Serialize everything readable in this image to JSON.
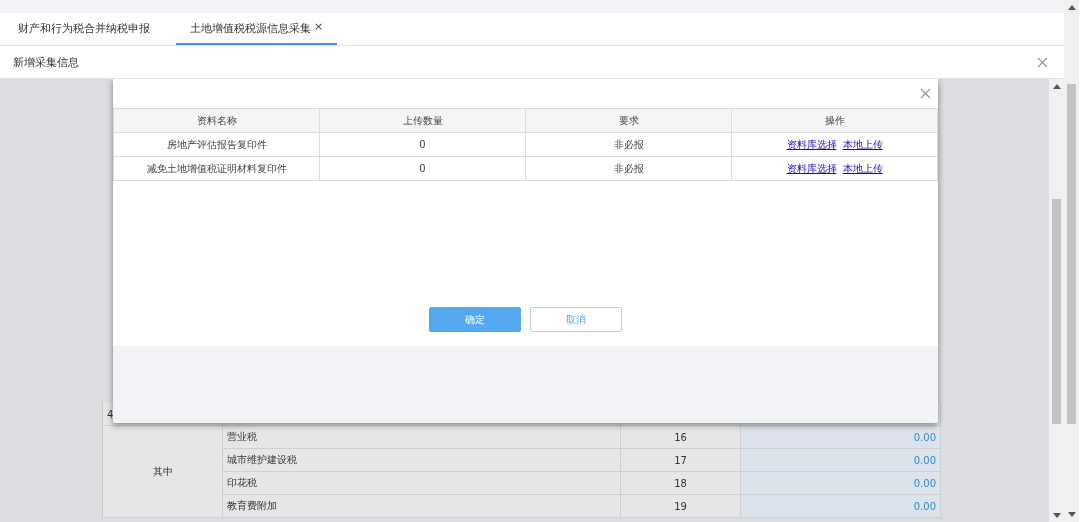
{
  "top_tabs": [
    {
      "label": "财产和行为税合并纳税申报",
      "selected": false,
      "closable": false
    },
    {
      "label": "土地增值税税源信息采集",
      "selected": true,
      "closable": true,
      "close_glyph": "×"
    }
  ],
  "panel": {
    "title": "新增采集信息"
  },
  "background_table": {
    "row_marker": "4",
    "group_label": "其中",
    "rows": [
      {
        "name": "营业税",
        "line": "16",
        "value": "0.00"
      },
      {
        "name": "城市维护建设税",
        "line": "17",
        "value": "0.00"
      },
      {
        "name": "印花税",
        "line": "18",
        "value": "0.00"
      },
      {
        "name": "教育费附加",
        "line": "19",
        "value": "0.00"
      }
    ]
  },
  "dialog": {
    "columns": [
      "资料名称",
      "上传数量",
      "要求",
      "操作"
    ],
    "rows": [
      {
        "name": "房地产评估报告复印件",
        "count": "0",
        "requirement": "非必报",
        "actions": [
          "资料库选择",
          "本地上传"
        ]
      },
      {
        "name": "减免土地增值税证明材料复印件",
        "count": "0",
        "requirement": "非必报",
        "actions": [
          "资料库选择",
          "本地上传"
        ]
      }
    ],
    "buttons": [
      {
        "label": "确定",
        "kind": "primary"
      },
      {
        "label": "取消",
        "kind": "secondary"
      }
    ]
  }
}
